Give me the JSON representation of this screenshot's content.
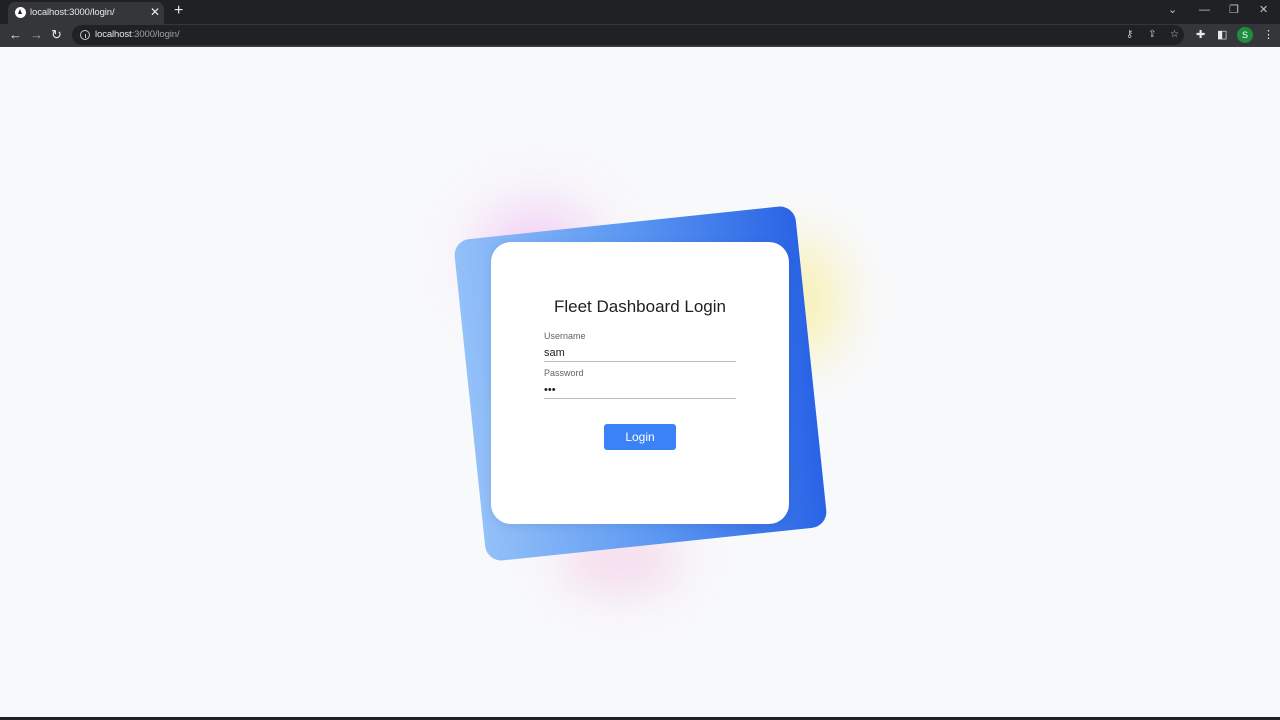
{
  "browser": {
    "tab_title": "localhost:3000/login/",
    "tab_close": "✕",
    "new_tab": "+",
    "url_host": "localhost",
    "url_rest": ":3000/login/",
    "profile_initial": "S",
    "icons": {
      "favicon": "app-triangle-icon",
      "back": "back-arrow-icon",
      "forward": "forward-arrow-icon",
      "reload": "reload-icon",
      "site_info": "info-icon",
      "password_key": "key-icon",
      "share": "share-icon",
      "bookmark": "star-icon",
      "extensions": "puzzle-icon",
      "side_panel": "side-panel-icon"
    },
    "window_controls": [
      "⌄",
      "—",
      "❐",
      "✕"
    ]
  },
  "login": {
    "title": "Fleet Dashboard Login",
    "username_label": "Username",
    "username_value": "sam",
    "password_label": "Password",
    "password_value": "sam",
    "button_label": "Login"
  },
  "colors": {
    "accent": "#3b82f6",
    "gradient_start": "#93c0f8",
    "gradient_end": "#2a64e6",
    "page_background": "#f8f9fb"
  }
}
